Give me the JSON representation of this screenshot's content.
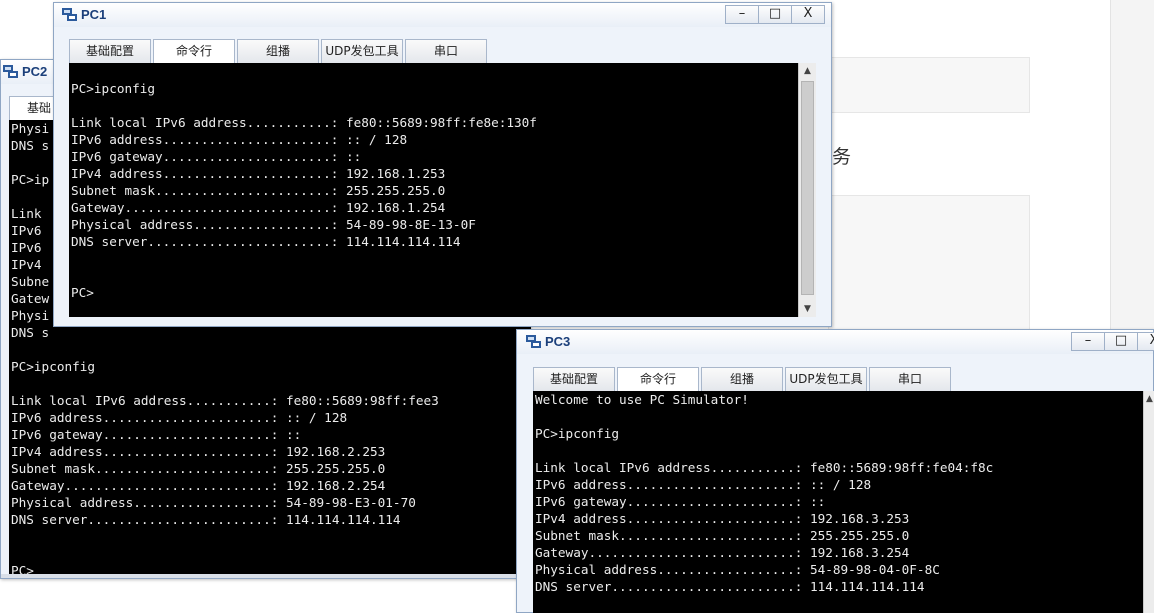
{
  "background": {
    "partial_text": "务"
  },
  "tabs": [
    "基础配置",
    "命令行",
    "组播",
    "UDP发包工具",
    "串口"
  ],
  "controls": {
    "minimize": "–",
    "maximize": "□",
    "close": "X"
  },
  "pc2": {
    "title": "PC2",
    "tab_visible": "基础",
    "lines": [
      "Physi",
      "DNS s",
      "",
      "PC>ip",
      "",
      "Link ",
      "IPv6 ",
      "IPv6 ",
      "IPv4 ",
      "Subne",
      "Gatew",
      "Physi",
      "DNS s",
      "",
      "PC>ipconfig",
      "",
      "Link local IPv6 address...........: fe80::5689:98ff:fee3",
      "IPv6 address......................: :: / 128",
      "IPv6 gateway......................: ::",
      "IPv4 address......................: 192.168.2.253",
      "Subnet mask.......................: 255.255.255.0",
      "Gateway...........................: 192.168.2.254",
      "Physical address..................: 54-89-98-E3-01-70",
      "DNS server........................: 114.114.114.114",
      "",
      "",
      "PC>"
    ]
  },
  "pc1": {
    "title": "PC1",
    "lines": [
      "",
      "PC>ipconfig",
      "",
      "Link local IPv6 address...........: fe80::5689:98ff:fe8e:130f",
      "IPv6 address......................: :: / 128",
      "IPv6 gateway......................: ::",
      "IPv4 address......................: 192.168.1.253",
      "Subnet mask.......................: 255.255.255.0",
      "Gateway...........................: 192.168.1.254",
      "Physical address..................: 54-89-98-8E-13-0F",
      "DNS server........................: 114.114.114.114",
      "",
      "",
      "PC>"
    ]
  },
  "pc3": {
    "title": "PC3",
    "lines": [
      "Welcome to use PC Simulator!",
      "",
      "PC>ipconfig",
      "",
      "Link local IPv6 address...........: fe80::5689:98ff:fe04:f8c",
      "IPv6 address......................: :: / 128",
      "IPv6 gateway......................: ::",
      "IPv4 address......................: 192.168.3.253",
      "Subnet mask.......................: 255.255.255.0",
      "Gateway...........................: 192.168.3.254",
      "Physical address..................: 54-89-98-04-0F-8C",
      "DNS server........................: 114.114.114.114"
    ]
  }
}
